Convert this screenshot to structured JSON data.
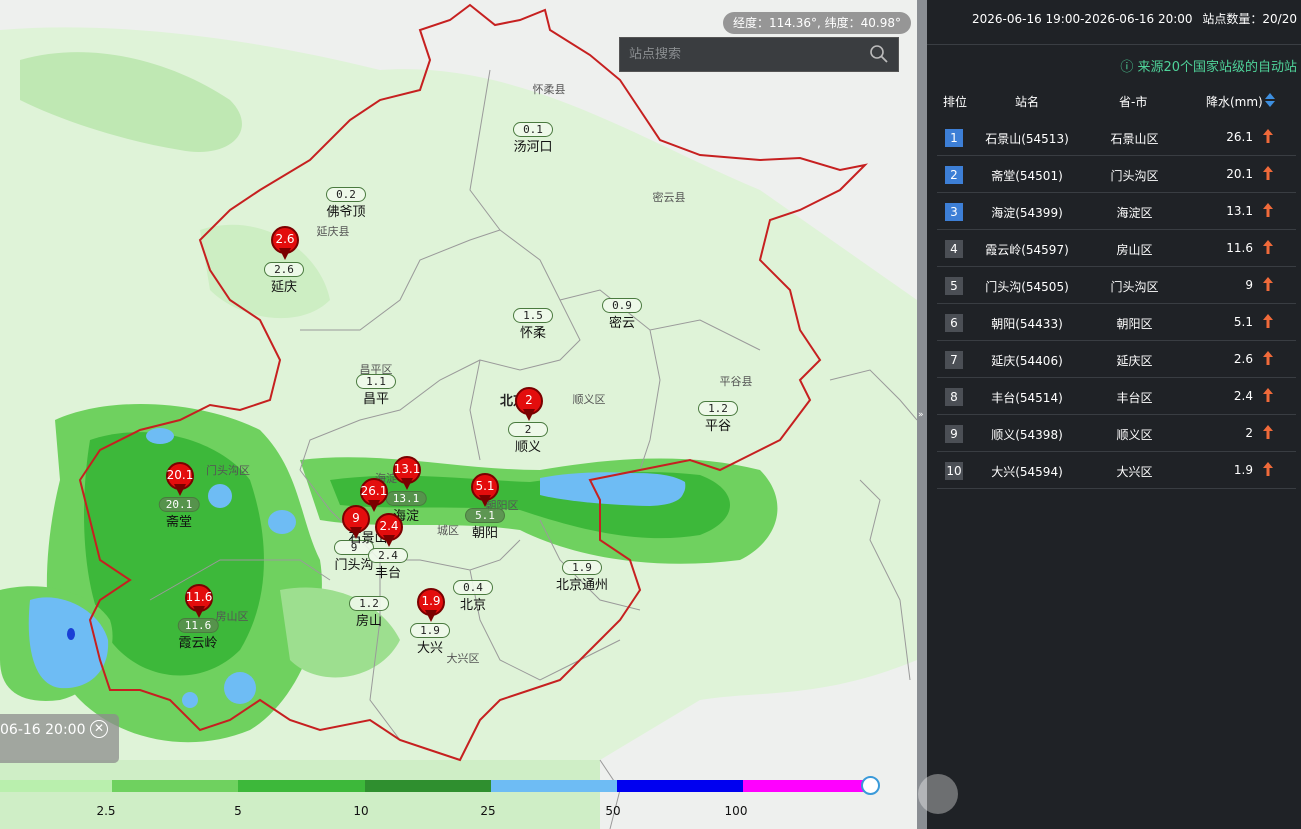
{
  "header": {
    "time_range": "2026-06-16 19:00-2026-06-16 20:00",
    "station_count_label": "站点数量：20/20",
    "source_note": "来源20个国家站级的自动站"
  },
  "map": {
    "coord_readout": "经度：114.36°, 纬度：40.98°",
    "search": {
      "placeholder": "站点搜索"
    },
    "time_label": "06-16 20:00",
    "legend": {
      "labels": [
        "2.5",
        "5",
        "10",
        "25",
        "50",
        "100"
      ],
      "colors": [
        "#b9efad",
        "#6fd15f",
        "#3db83a",
        "#2f8f2f",
        "#6ebcf4",
        "#0000f0",
        "#ff00ff"
      ]
    },
    "place_names": [
      "怀柔县",
      "密云县",
      "延庆县",
      "昌平区",
      "顺义区",
      "平谷县",
      "门头沟区",
      "海淀",
      "城区",
      "朝阳区",
      "房山区",
      "大兴区",
      "北京"
    ],
    "stations": [
      {
        "name": "汤河口",
        "value": "0.1"
      },
      {
        "name": "佛爷顶",
        "value": "0.2"
      },
      {
        "name": "延庆",
        "value": "2.6",
        "pin": "2.6"
      },
      {
        "name": "怀柔",
        "value": "1.5"
      },
      {
        "name": "密云",
        "value": "0.9"
      },
      {
        "name": "昌平",
        "value": "1.1"
      },
      {
        "name": "顺义",
        "value": "2",
        "pin": "2"
      },
      {
        "name": "平谷",
        "value": "1.2"
      },
      {
        "name": "斋堂",
        "value": "20.1",
        "pin": "20.1"
      },
      {
        "name": "海淀",
        "value": "13.1",
        "pin": "13.1"
      },
      {
        "name": "石景山",
        "value": "",
        "pin": "26.1"
      },
      {
        "name": "朝阳",
        "value": "5.1",
        "pin": "5.1"
      },
      {
        "name": "门头沟",
        "value": "9",
        "pin": "9"
      },
      {
        "name": "丰台",
        "value": "2.4",
        "pin": "2.4"
      },
      {
        "name": "北京通州",
        "value": "1.9"
      },
      {
        "name": "北京",
        "value": "0.4"
      },
      {
        "name": "房山",
        "value": "1.2"
      },
      {
        "name": "大兴",
        "value": "1.9",
        "pin": "1.9"
      },
      {
        "name": "霞云岭",
        "value": "11.6",
        "pin": "11.6"
      }
    ]
  },
  "table": {
    "headers": {
      "rank": "排位",
      "station": "站名",
      "province": "省-市",
      "rain": "降水(mm)"
    },
    "rows": [
      {
        "rank": "1",
        "name": "石景山(54513)",
        "prov": "石景山区",
        "rain": "26.1"
      },
      {
        "rank": "2",
        "name": "斋堂(54501)",
        "prov": "门头沟区",
        "rain": "20.1"
      },
      {
        "rank": "3",
        "name": "海淀(54399)",
        "prov": "海淀区",
        "rain": "13.1"
      },
      {
        "rank": "4",
        "name": "霞云岭(54597)",
        "prov": "房山区",
        "rain": "11.6"
      },
      {
        "rank": "5",
        "name": "门头沟(54505)",
        "prov": "门头沟区",
        "rain": "9"
      },
      {
        "rank": "6",
        "name": "朝阳(54433)",
        "prov": "朝阳区",
        "rain": "5.1"
      },
      {
        "rank": "7",
        "name": "延庆(54406)",
        "prov": "延庆区",
        "rain": "2.6"
      },
      {
        "rank": "8",
        "name": "丰台(54514)",
        "prov": "丰台区",
        "rain": "2.4"
      },
      {
        "rank": "9",
        "name": "顺义(54398)",
        "prov": "顺义区",
        "rain": "2"
      },
      {
        "rank": "10",
        "name": "大兴(54594)",
        "prov": "大兴区",
        "rain": "1.9"
      }
    ]
  }
}
